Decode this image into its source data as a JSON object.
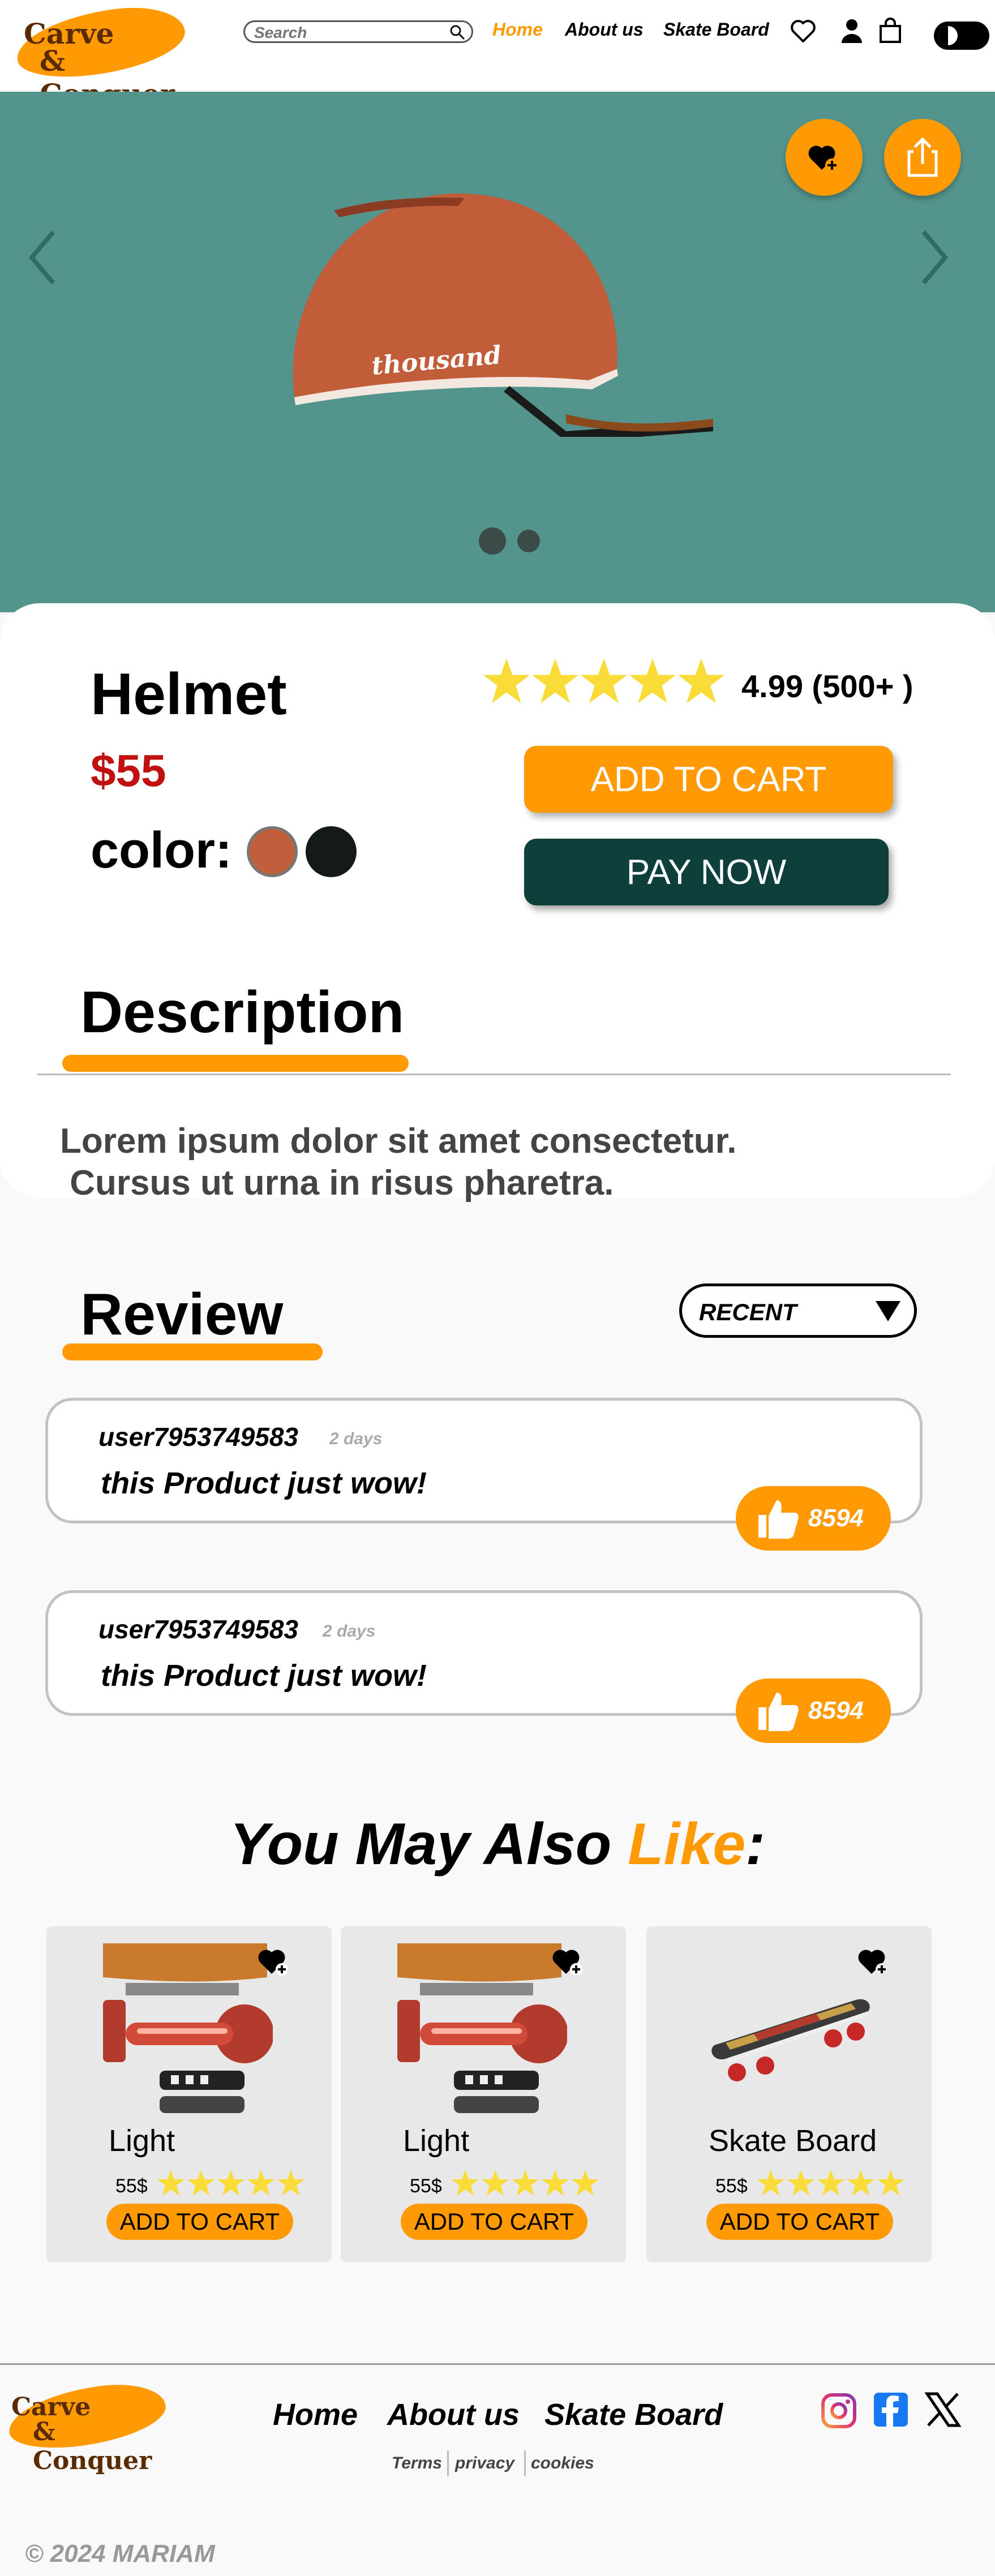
{
  "brand": {
    "line1": "Carve",
    "line2": "& Conquer"
  },
  "header": {
    "search_placeholder": "Search",
    "nav": {
      "home": "Home",
      "about": "About us",
      "skate": "Skate Board"
    }
  },
  "colors": {
    "accent": "#ff9a05",
    "hero_bg": "#53958d",
    "pay_btn": "#0e3f3a",
    "price": "#c01010"
  },
  "hero": {
    "helmet_brand": "thousand",
    "slides_total": 2,
    "active_slide": 1
  },
  "product": {
    "name": "Helmet",
    "price": "$55",
    "color_label": "color:",
    "colors": [
      "#c15f3c",
      "#131a17"
    ],
    "rating_text": "4.99 (500+ )",
    "stars": 5,
    "add_to_cart": "ADD TO CART",
    "pay_now": "PAY NOW"
  },
  "description": {
    "title": "Description",
    "line1": "Lorem ipsum dolor sit amet consectetur.",
    "line2": " Cursus ut urna in risus pharetra."
  },
  "review": {
    "title": "Review",
    "sort_label": "RECENT",
    "items": [
      {
        "user": "user7953749583",
        "time": "2 days",
        "text": "this Product just wow!",
        "likes": "8594"
      },
      {
        "user": "user7953749583",
        "time": "2 days",
        "text": "this Product  just wow!",
        "likes": "8594"
      }
    ]
  },
  "also_like": {
    "part1": "You May Also ",
    "part2": "Like",
    "part3": ":",
    "products": [
      {
        "title": "Light",
        "price": "55$",
        "button": "ADD TO CART",
        "image": "light"
      },
      {
        "title": "Light",
        "price": "55$",
        "button": "ADD TO CART",
        "image": "light"
      },
      {
        "title": "Skate Board",
        "price": "55$",
        "button": "ADD TO CART",
        "image": "skateboard"
      }
    ]
  },
  "footer": {
    "links": {
      "home": "Home",
      "about": "About us",
      "skate": "Skate Board"
    },
    "small": {
      "terms": "Terms",
      "privacy": "privacy",
      "cookies": "cookies"
    },
    "copyright": "© 2024  MARIAM"
  }
}
